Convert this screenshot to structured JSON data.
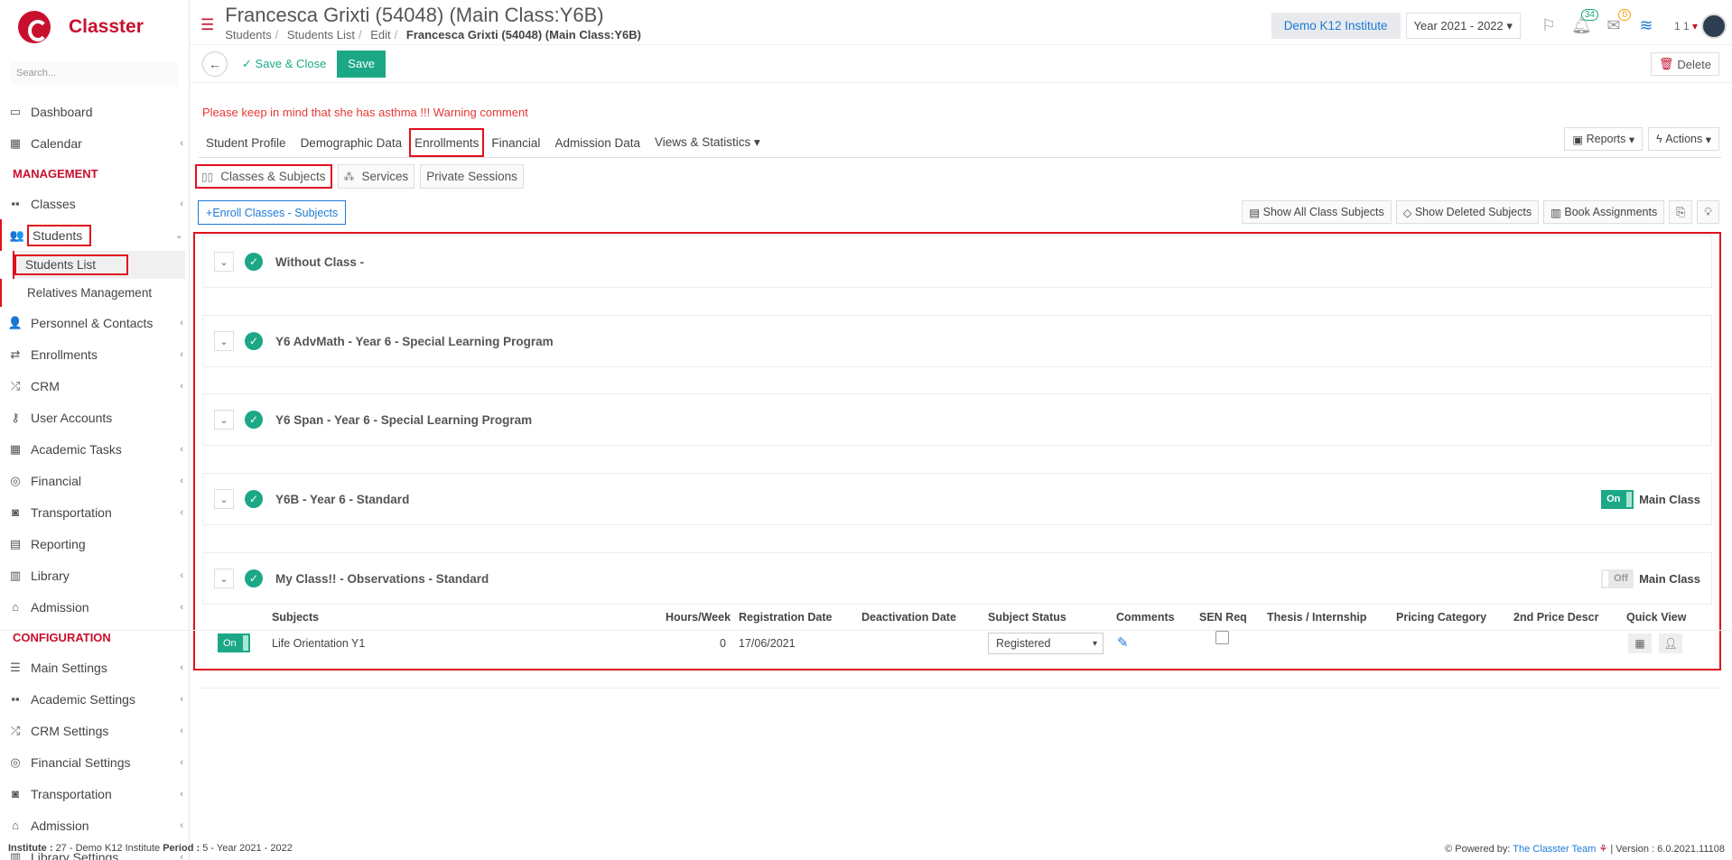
{
  "app": {
    "name": "Classter"
  },
  "sidebar": {
    "search_placeholder": "Search...",
    "items": [
      {
        "label": "Dashboard",
        "icon": "laptop-icon",
        "glyph": "▭"
      },
      {
        "label": "Calendar",
        "icon": "calendar-icon",
        "glyph": "▦",
        "chev": true
      },
      {
        "section": "MANAGEMENT"
      },
      {
        "label": "Classes",
        "icon": "classes-icon",
        "glyph": "▪▪",
        "chev": true
      },
      {
        "label": "Students",
        "icon": "students-icon",
        "glyph": "👥",
        "chev": true,
        "open": true,
        "children": [
          {
            "label": "Students List",
            "active": true
          },
          {
            "label": "Relatives Management"
          }
        ]
      },
      {
        "label": "Personnel & Contacts",
        "icon": "personnel-icon",
        "glyph": "👤",
        "chev": true
      },
      {
        "label": "Enrollments",
        "icon": "exchange-icon",
        "glyph": "⇄",
        "chev": true
      },
      {
        "label": "CRM",
        "icon": "shuffle-icon",
        "glyph": "⤮",
        "chev": true
      },
      {
        "label": "User Accounts",
        "icon": "key-icon",
        "glyph": "⚷"
      },
      {
        "label": "Academic Tasks",
        "icon": "grid-icon",
        "glyph": "▦",
        "chev": true
      },
      {
        "label": "Financial",
        "icon": "coins-icon",
        "glyph": "◎",
        "chev": true
      },
      {
        "label": "Transportation",
        "icon": "bus-icon",
        "glyph": "◙",
        "chev": true
      },
      {
        "label": "Reporting",
        "icon": "print-icon",
        "glyph": "▤"
      },
      {
        "label": "Library",
        "icon": "books-icon",
        "glyph": "▥",
        "chev": true
      },
      {
        "label": "Admission",
        "icon": "institution-icon",
        "glyph": "⌂",
        "chev": true
      },
      {
        "section": "CONFIGURATION"
      },
      {
        "label": "Main Settings",
        "icon": "sliders-icon",
        "glyph": "☰",
        "chev": true
      },
      {
        "label": "Academic Settings",
        "icon": "classes-icon",
        "glyph": "▪▪",
        "chev": true
      },
      {
        "label": "CRM Settings",
        "icon": "shuffle-icon",
        "glyph": "⤮",
        "chev": true
      },
      {
        "label": "Financial Settings",
        "icon": "coins-icon",
        "glyph": "◎",
        "chev": true
      },
      {
        "label": "Transportation",
        "icon": "bus-icon",
        "glyph": "◙",
        "chev": true
      },
      {
        "label": "Admission",
        "icon": "institution-icon",
        "glyph": "⌂",
        "chev": true
      },
      {
        "label": "Library Settings",
        "icon": "books-icon",
        "glyph": "▥",
        "chev": true
      }
    ]
  },
  "header": {
    "title": "Francesca Grixti (54048) (Main Class:Y6B)",
    "breadcrumbs": [
      "Students",
      "Students List",
      "Edit"
    ],
    "breadcrumb_current": "Francesca Grixti (54048) (Main Class:Y6B)",
    "institute": "Demo K12 Institute",
    "year": "Year 2021 - 2022",
    "notif_count": "34",
    "mail_count": "0",
    "user_mini": "1 1"
  },
  "toolbar": {
    "save_close": "Save & Close",
    "save": "Save",
    "delete": "Delete"
  },
  "warning": "Please keep in mind that she has asthma !!! Warning comment",
  "tabs": [
    {
      "label": "Student Profile"
    },
    {
      "label": "Demographic Data"
    },
    {
      "label": "Enrollments",
      "active": true
    },
    {
      "label": "Financial"
    },
    {
      "label": "Admission Data"
    },
    {
      "label": "Views & Statistics ▾"
    }
  ],
  "right_tools": {
    "reports": "Reports",
    "actions": "Actions"
  },
  "subtabs": [
    {
      "label": "Classes & Subjects",
      "active": true
    },
    {
      "label": "Services"
    },
    {
      "label": "Private Sessions"
    }
  ],
  "enroll_button": "Enroll Classes - Subjects",
  "tools2": {
    "show_all": "Show All Class Subjects",
    "show_deleted": "Show Deleted Subjects",
    "book": "Book Assignments"
  },
  "classes": [
    {
      "title": "Without Class -"
    },
    {
      "title": "Y6 AdvMath - Year 6 - Special Learning Program"
    },
    {
      "title": "Y6 Span - Year 6 - Special Learning Program"
    },
    {
      "title": "Y6B - Year 6 - Standard",
      "main_class": "On",
      "main_label": "Main Class"
    },
    {
      "title": "My Class!! - Observations - Standard",
      "main_class": "Off",
      "main_label": "Main Class"
    }
  ],
  "subjects_table": {
    "columns": [
      "Subjects",
      "Hours/Week",
      "Registration Date",
      "Deactivation Date",
      "Subject Status",
      "Comments",
      "SEN Req",
      "Thesis / Internship",
      "Pricing Category",
      "2nd Price Descr",
      "Quick View"
    ],
    "rows": [
      {
        "toggle": "On",
        "subject": "Life Orientation Y1",
        "hours": "0",
        "registration": "17/06/2021",
        "deactivation": "",
        "status": "Registered"
      }
    ]
  },
  "footer": {
    "institute_label": "Institute :",
    "institute_value": "27 - Demo K12 Institute",
    "period_label": "Period :",
    "period_value": "5 - Year 2021 - 2022",
    "powered": "Powered by:",
    "team": "The Classter Team",
    "version": "| Version : 6.0.2021.11108"
  },
  "colors": {
    "brand": "#c8102e",
    "accent": "#1ca886",
    "link": "#1c7ad6",
    "highlight": "#e0101e"
  }
}
